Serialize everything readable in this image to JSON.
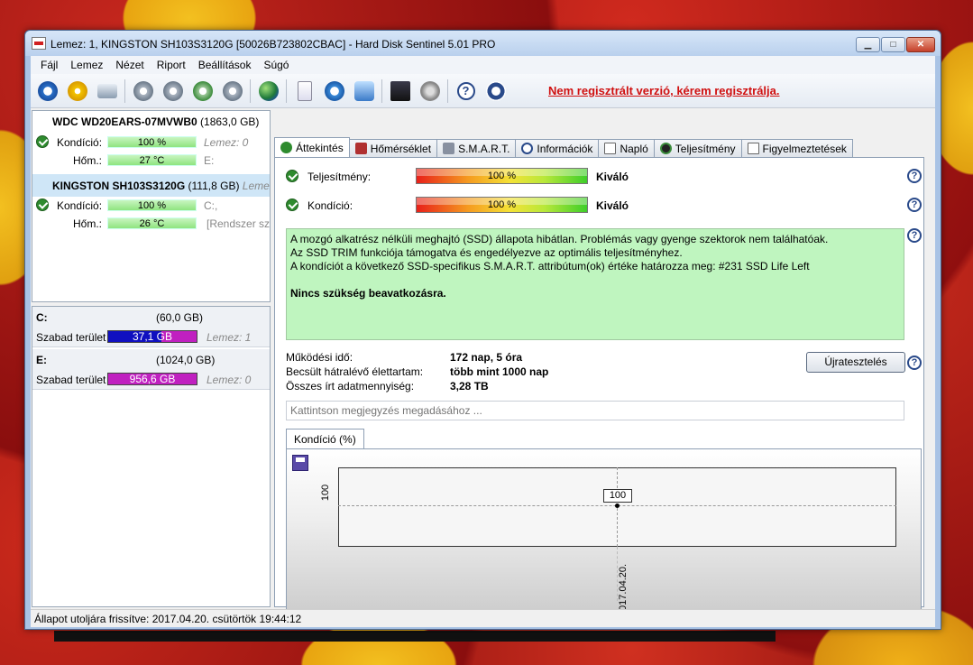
{
  "window": {
    "title": "Lemez: 1, KINGSTON SH103S3120G [50026B723802CBAC]  -  Hard Disk Sentinel 5.01 PRO",
    "minimize": "▁",
    "maximize": "□",
    "close": "✕"
  },
  "menu": [
    "Fájl",
    "Lemez",
    "Nézet",
    "Riport",
    "Beállítások",
    "Súgó"
  ],
  "toolbar": {
    "unregistered": "Nem regisztrált verzió, kérem regisztrálja."
  },
  "disks": [
    {
      "name": "WDC WD20EARS-07MVWB0",
      "size": "(1863,0 GB)",
      "condition_label": "Kondíció:",
      "condition": "100 %",
      "condition_pct": 100,
      "temp_label": "Hőm.:",
      "temp": "27 °C",
      "note1": "Lemez: 0",
      "note2": "E:"
    },
    {
      "name": "KINGSTON SH103S3120G",
      "size": "(111,8 GB)",
      "extra": "Lemez",
      "condition_label": "Kondíció:",
      "condition": "100 %",
      "condition_pct": 100,
      "temp_label": "Hőm.:",
      "temp": "26 °C",
      "note1": "C:,",
      "note2": "[Rendszer szá"
    }
  ],
  "volumes": [
    {
      "name": "C:",
      "size": "(60,0 GB)",
      "free_label": "Szabad terület",
      "free": "37,1 GB",
      "disk": "Lemez: 1",
      "color": "#1010c0",
      "color2": "#c020c0"
    },
    {
      "name": "E:",
      "size": "(1024,0 GB)",
      "free_label": "Szabad terület",
      "free": "956,6 GB",
      "disk": "Lemez: 0",
      "color": "#c020c0",
      "color2": "#c020c0"
    }
  ],
  "tabs": [
    "Áttekintés",
    "Hőmérséklet",
    "S.M.A.R.T.",
    "Információk",
    "Napló",
    "Teljesítmény",
    "Figyelmeztetések"
  ],
  "overview": {
    "performance_label": "Teljesítmény:",
    "performance_value": "100 %",
    "performance_pct": 100,
    "performance_rating": "Kiváló",
    "condition_label": "Kondíció:",
    "condition_value": "100 %",
    "condition_pct": 100,
    "condition_rating": "Kiváló",
    "message_lines": [
      "A mozgó alkatrész nélküli meghajtó (SSD) állapota hibátlan. Problémás vagy gyenge szektorok nem találhatóak.",
      "Az SSD TRIM funkciója támogatva és engedélyezve az optimális teljesítményhez.",
      "A kondíciót a következő SSD-specifikus S.M.A.R.T. attribútum(ok) értéke határozza meg:  #231 SSD Life Left"
    ],
    "message_bold": "Nincs szükség beavatkozásra.",
    "uptime_label": "Működési idő:",
    "uptime_value": "172 nap, 5 óra",
    "lifetime_label": "Becsült hátralévő élettartam:",
    "lifetime_value": "több mint 1000 nap",
    "written_label": "Összes írt adatmennyiség:",
    "written_value": "3,28 TB",
    "retest_button": "Újratesztelés",
    "note_placeholder": "Kattintson megjegyzés megadásához ...",
    "chart_tab": "Kondíció  (%)",
    "help": "?"
  },
  "chart_data": {
    "type": "line",
    "title": "",
    "xlabel": "",
    "ylabel": "",
    "x": [
      "2017.04.20."
    ],
    "series": [
      {
        "name": "Kondíció (%)",
        "values": [
          100
        ]
      }
    ],
    "point_label": "100",
    "y_tick": "100",
    "x_tick": "2017.04.20."
  },
  "statusbar": "Állapot utoljára frissítve: 2017.04.20. csütörtök 19:44:12"
}
